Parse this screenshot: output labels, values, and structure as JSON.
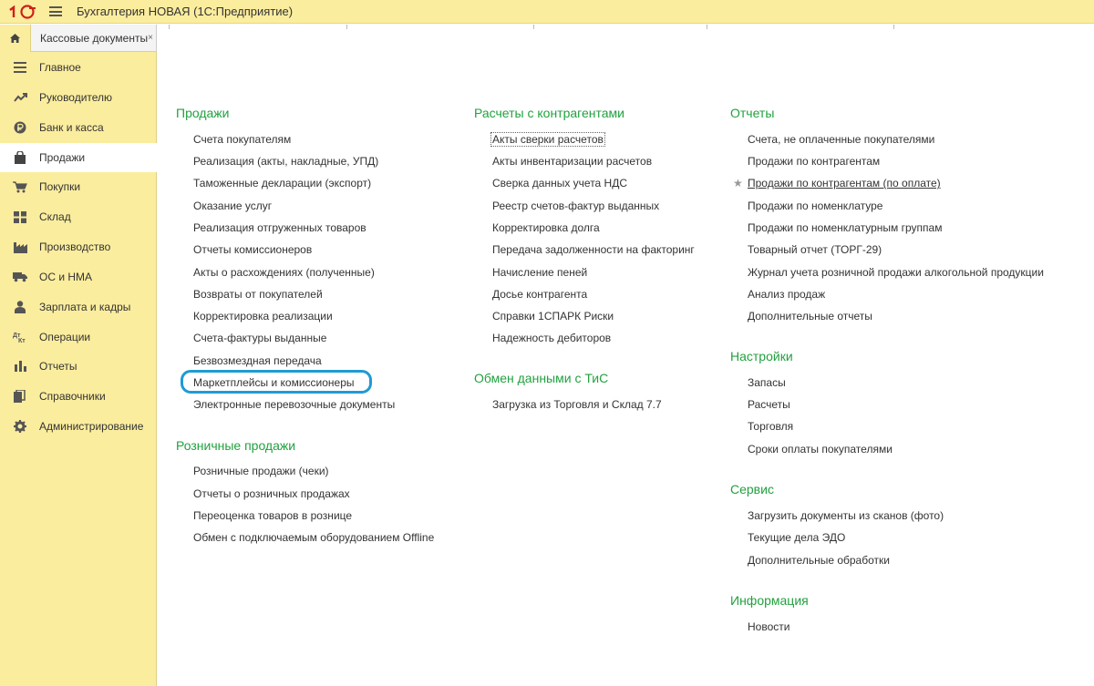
{
  "titlebar": {
    "logo": "1С",
    "title": "Бухгалтерия НОВАЯ  (1С:Предприятие)"
  },
  "tabs": {
    "active_label": "Кассовые документы",
    "close_glyph": "×"
  },
  "sidebar": {
    "items": [
      {
        "label": "Главное",
        "icon": "list-icon"
      },
      {
        "label": "Руководителю",
        "icon": "trend-icon"
      },
      {
        "label": "Банк и касса",
        "icon": "ruble-coin-icon"
      },
      {
        "label": "Продажи",
        "icon": "shopping-bag-icon",
        "active": true
      },
      {
        "label": "Покупки",
        "icon": "cart-icon"
      },
      {
        "label": "Склад",
        "icon": "grid-icon"
      },
      {
        "label": "Производство",
        "icon": "factory-icon"
      },
      {
        "label": "ОС и НМА",
        "icon": "truck-icon"
      },
      {
        "label": "Зарплата и кадры",
        "icon": "person-icon"
      },
      {
        "label": "Операции",
        "icon": "dt-kt-icon"
      },
      {
        "label": "Отчеты",
        "icon": "bar-chart-icon"
      },
      {
        "label": "Справочники",
        "icon": "books-icon"
      },
      {
        "label": "Администрирование",
        "icon": "gear-icon"
      }
    ]
  },
  "col1": {
    "sales": {
      "title": "Продажи",
      "links": [
        "Счета покупателям",
        "Реализация (акты, накладные, УПД)",
        "Таможенные декларации (экспорт)",
        "Оказание услуг",
        "Реализация отгруженных товаров",
        "Отчеты комиссионеров",
        "Акты о расхождениях (полученные)",
        "Возвраты от покупателей",
        "Корректировка реализации",
        "Счета-фактуры выданные",
        "Безвозмездная передача",
        "Маркетплейсы и комиссионеры",
        "Электронные перевозочные документы"
      ]
    },
    "retail": {
      "title": "Розничные продажи",
      "links": [
        "Розничные продажи (чеки)",
        "Отчеты о розничных продажах",
        "Переоценка товаров в рознице",
        "Обмен с подключаемым оборудованием Offline"
      ]
    }
  },
  "col2": {
    "settlements": {
      "title": "Расчеты с контрагентами",
      "links": [
        "Акты сверки расчетов",
        "Акты инвентаризации расчетов",
        "Сверка данных учета НДС",
        "Реестр счетов-фактур выданных",
        "Корректировка долга",
        "Передача задолженности на факторинг",
        "Начисление пеней",
        "Досье контрагента",
        "Справки 1СПАРК Риски",
        "Надежность дебиторов"
      ]
    },
    "exchange": {
      "title": "Обмен данными с ТиС",
      "links": [
        "Загрузка из Торговля и Склад 7.7"
      ]
    }
  },
  "col3": {
    "reports": {
      "title": "Отчеты",
      "links": [
        "Счета, не оплаченные покупателями",
        "Продажи по контрагентам",
        "Продажи по контрагентам (по оплате)",
        "Продажи по номенклатуре",
        "Продажи по номенклатурным группам",
        "Товарный отчет (ТОРГ-29)",
        "Журнал учета розничной продажи алкогольной продукции",
        "Анализ продаж",
        "Дополнительные отчеты"
      ],
      "star_glyph": "★"
    },
    "settings": {
      "title": "Настройки",
      "links": [
        "Запасы",
        "Расчеты",
        "Торговля",
        "Сроки оплаты покупателями"
      ]
    },
    "service": {
      "title": "Сервис",
      "links": [
        "Загрузить документы из сканов (фото)",
        "Текущие дела ЭДО",
        "Дополнительные обработки"
      ]
    },
    "info": {
      "title": "Информация",
      "links": [
        "Новости"
      ]
    }
  },
  "colors": {
    "panel": "#fbed9e",
    "section_title": "#21a13f",
    "highlight": "#1f9bd4"
  }
}
